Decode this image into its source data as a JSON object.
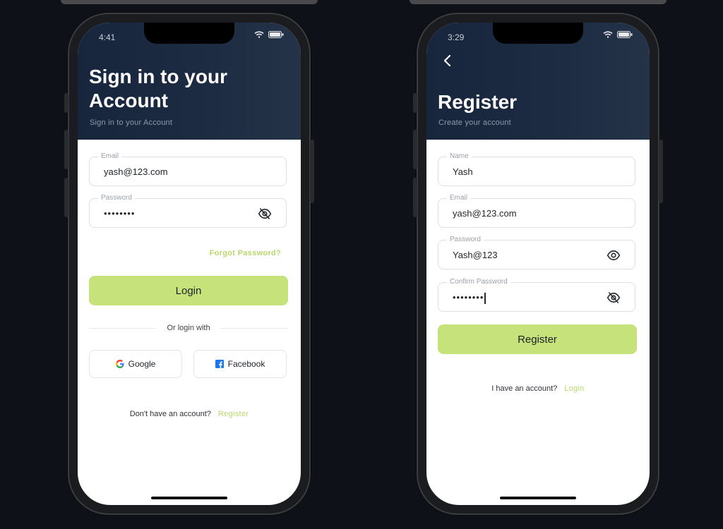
{
  "colors": {
    "accent": "#c6e27a",
    "header": "#1d2b42",
    "link": "#b9d86c"
  },
  "signin": {
    "status_time": "4:41",
    "title_line1": "Sign in to your",
    "title_line2": "Account",
    "subtitle": "Sign in to your Account",
    "email_label": "Email",
    "email_value": "yash@123.com",
    "password_label": "Password",
    "password_value": "••••••••",
    "password_icon": "eye-off-icon",
    "forgot_label": "Forgot Password?",
    "login_label": "Login",
    "divider_text": "Or login with",
    "google_label": "Google",
    "facebook_label": "Facebook",
    "footer_text": "Don't have an account?",
    "footer_link": "Register"
  },
  "register": {
    "status_time": "3:29",
    "back_icon": "chevron-left-icon",
    "title": "Register",
    "subtitle": "Create your account",
    "name_label": "Name",
    "name_value": "Yash",
    "email_label": "Email",
    "email_value": "yash@123.com",
    "password_label": "Password",
    "password_value": "Yash@123",
    "password_icon": "eye-icon",
    "confirm_label": "Confirm Password",
    "confirm_value": "••••••••",
    "confirm_icon": "eye-off-icon",
    "register_label": "Register",
    "footer_text": "I have an account?",
    "footer_link": "Login"
  }
}
